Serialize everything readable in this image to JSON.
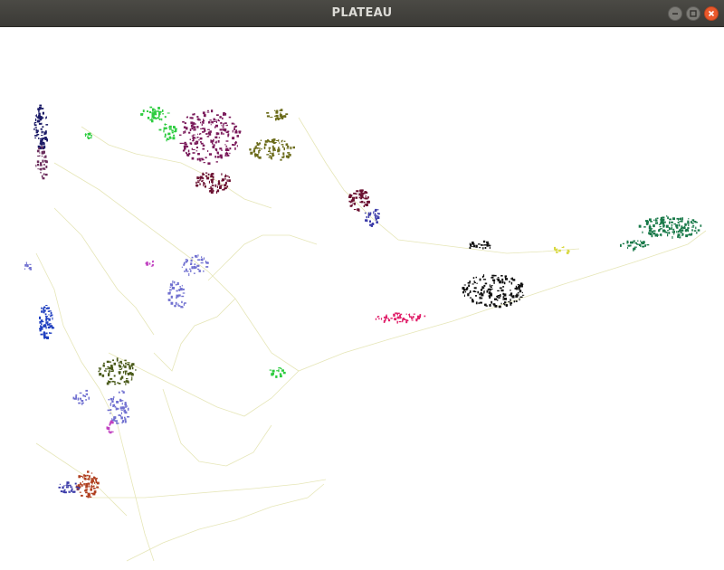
{
  "window": {
    "title": "PLATEAU",
    "controls": {
      "minimize_icon": "minimize-icon",
      "maximize_icon": "maximize-icon",
      "close_icon": "close-icon"
    }
  },
  "colors": {
    "titlebar": "#3f3e3a",
    "title_text": "#dcdbd6",
    "close_button": "#e9582b",
    "road_lines": "#e6e6b8",
    "background": "#ffffff"
  },
  "map": {
    "building_clusters": [
      {
        "color": "#1a1a66"
      },
      {
        "color": "#6b2d5c"
      },
      {
        "color": "#2ecc40"
      },
      {
        "color": "#7a1a5a"
      },
      {
        "color": "#6b6b1a"
      },
      {
        "color": "#6a1030"
      },
      {
        "color": "#3a3aa8"
      },
      {
        "color": "#101010"
      },
      {
        "color": "#1a7a4a"
      },
      {
        "color": "#e0206a"
      },
      {
        "color": "#2040c0"
      },
      {
        "color": "#7070d0"
      },
      {
        "color": "#4a5a1a"
      },
      {
        "color": "#c040c0"
      },
      {
        "color": "#b04020"
      },
      {
        "color": "#d8d840"
      }
    ]
  }
}
